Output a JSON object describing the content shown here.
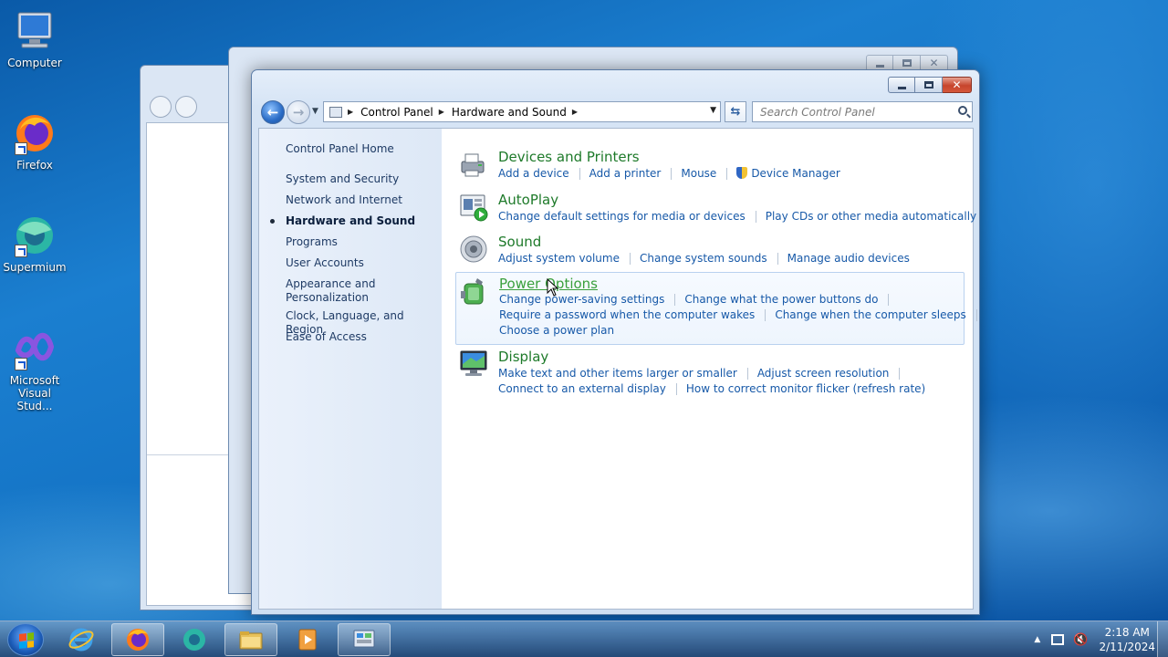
{
  "desktop": {
    "icons": [
      {
        "label": "Computer"
      },
      {
        "label": "Firefox"
      },
      {
        "label": "Supermium"
      },
      {
        "label": "Microsoft Visual Stud..."
      }
    ]
  },
  "window": {
    "address": {
      "crumbs": [
        "Control Panel",
        "Hardware and Sound"
      ]
    },
    "search": {
      "placeholder": "Search Control Panel"
    },
    "left_pane": {
      "home": "Control Panel Home",
      "items": [
        "System and Security",
        "Network and Internet",
        "Hardware and Sound",
        "Programs",
        "User Accounts",
        "Appearance and Personalization",
        "Clock, Language, and Region",
        "Ease of Access"
      ],
      "active_index": 2
    },
    "categories": [
      {
        "title": "Devices and Printers",
        "tasks": [
          [
            "Add a device",
            "Add a printer",
            "Mouse",
            "Device Manager"
          ]
        ]
      },
      {
        "title": "AutoPlay",
        "tasks": [
          [
            "Change default settings for media or devices",
            "Play CDs or other media automatically"
          ]
        ]
      },
      {
        "title": "Sound",
        "tasks": [
          [
            "Adjust system volume",
            "Change system sounds",
            "Manage audio devices"
          ]
        ]
      },
      {
        "title": "Power Options",
        "tasks": [
          [
            "Change power-saving settings",
            "Change what the power buttons do"
          ],
          [
            "Require a password when the computer wakes",
            "Change when the computer sleeps"
          ],
          [
            "Choose a power plan"
          ]
        ]
      },
      {
        "title": "Display",
        "tasks": [
          [
            "Make text and other items larger or smaller",
            "Adjust screen resolution"
          ],
          [
            "Connect to an external display",
            "How to correct monitor flicker (refresh rate)"
          ]
        ]
      }
    ]
  },
  "taskbar": {
    "clock": {
      "time": "2:18 AM",
      "date": "2/11/2024"
    }
  },
  "colors": {
    "category_title": "#1e7a2a",
    "task_link": "#1759a8",
    "accent": "#1c5cb8"
  }
}
